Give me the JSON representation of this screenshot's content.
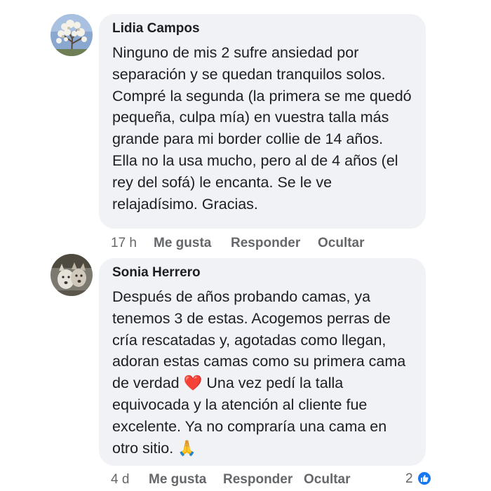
{
  "comments": [
    {
      "author": "Lidia Campos",
      "avatar": "flowering-tree-avatar",
      "lines": [
        "Ninguno de mis 2 sufre ansiedad por",
        "separación y se quedan tranquilos solos.",
        "Compré la segunda (la primera se me quedó",
        "pequeña, culpa mía) en vuestra talla más",
        "grande para mi border collie de 14 años.",
        "Ella no la usa mucho, pero al de 4 años (el",
        "rey del sofá) le encanta.  Se le ve",
        "relajadísimo.  Gracias."
      ],
      "time": "17 h",
      "like_label": "Me gusta",
      "reply_label": "Responder",
      "hide_label": "Ocultar"
    },
    {
      "author": "Sonia Herrero",
      "avatar": "dogs-avatar",
      "lines": [
        "Después de años probando camas, ya",
        "tenemos 3 de estas.  Acogemos perras de",
        "cría rescatadas y, agotadas como llegan,",
        "adoran estas camas como su primera cama",
        "de verdad",
        "Una vez pedí la talla",
        "equivocada y la atención al cliente fue",
        "excelente.  Ya no compraría una cama en",
        "otro sitio."
      ],
      "emoji_heart": "❤️",
      "emoji_pray": "🙏",
      "time": "4 d",
      "like_label": "Me gusta",
      "reply_label": "Responder",
      "hide_label": "Ocultar",
      "reaction_count": "2",
      "reaction_icon": "thumbs-up-icon",
      "reaction_color": "#1877f2"
    }
  ],
  "colors": {
    "bubble": "#f0f2f5",
    "meta": "#65676b",
    "text": "#1c1e21",
    "like_blue": "#1877f2"
  }
}
